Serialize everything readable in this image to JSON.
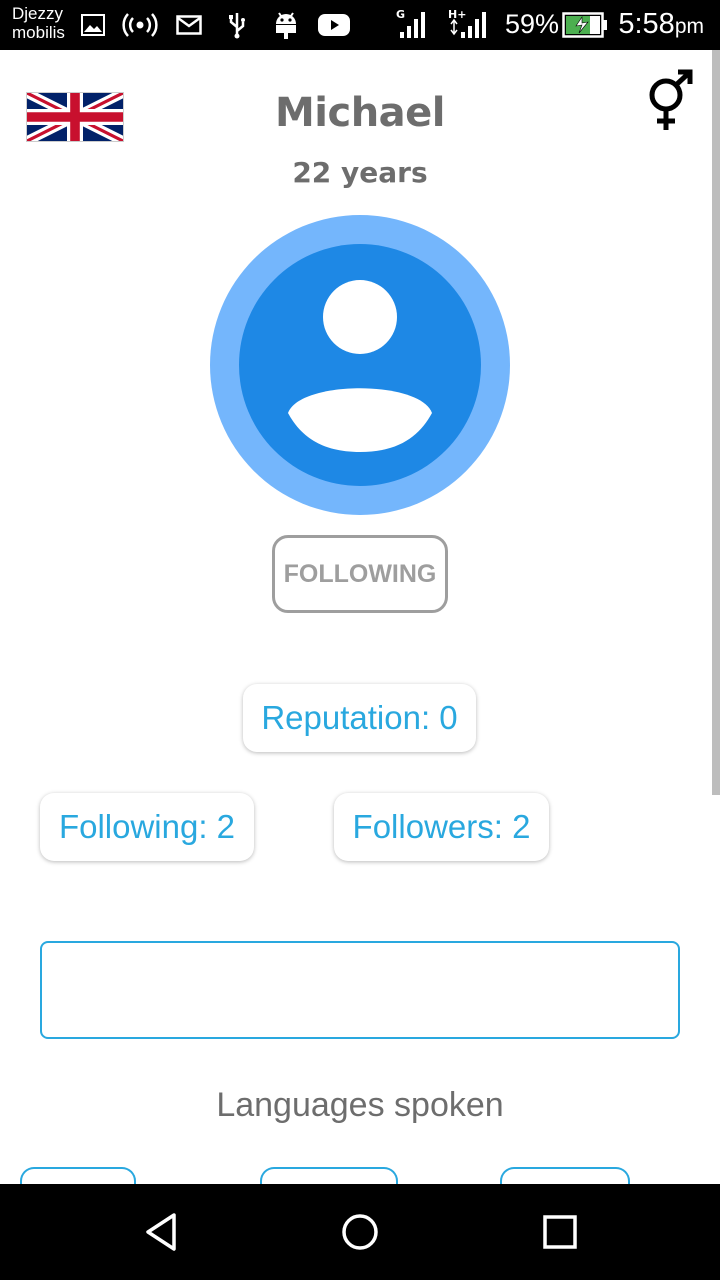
{
  "status_bar": {
    "carrier_line1": "Djezzy",
    "carrier_line2": "mobilis",
    "network_label_1": "G",
    "network_label_2": "H+",
    "battery_percent": "59%",
    "time": "5:58",
    "time_suffix": "pm",
    "icons": [
      "gallery-icon",
      "hotspot-icon",
      "mail-icon",
      "usb-icon",
      "android-icon",
      "youtube-icon",
      "signal-icon",
      "signal-icon",
      "battery-charging-icon"
    ]
  },
  "profile": {
    "name": "Michael",
    "age": "22 years",
    "flag": "uk-flag-icon",
    "gender_icon": "male-female-icon",
    "avatar_icon": "default-avatar-icon",
    "follow_button_label": "FOLLOWING"
  },
  "stats": {
    "reputation": "Reputation: 0",
    "following": "Following: 2",
    "followers": "Followers: 2"
  },
  "bio": {
    "value": ""
  },
  "languages": {
    "title": "Languages spoken"
  },
  "nav_bar": {
    "icons": [
      "back-icon",
      "home-icon",
      "recents-icon"
    ]
  },
  "colors": {
    "accent": "#29a8df",
    "avatar_outer": "#74b6fc",
    "avatar_inner": "#1e88e5",
    "text_gray": "#6d6d6d",
    "button_gray": "#9e9e9e"
  }
}
